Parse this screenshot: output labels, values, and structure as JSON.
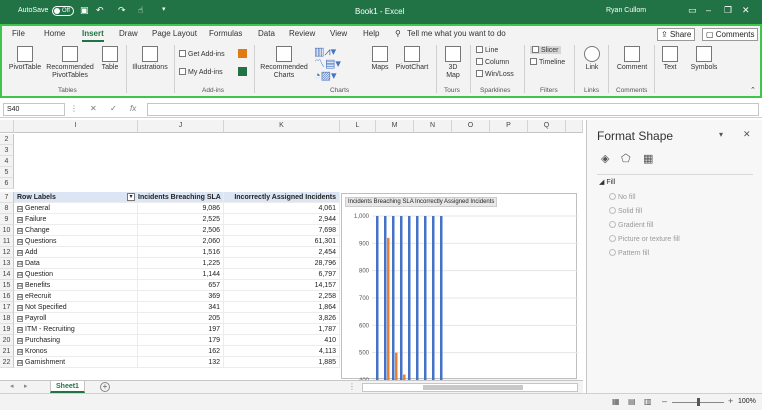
{
  "titlebar": {
    "autosave_label": "AutoSave",
    "autosave_state": "Off",
    "document_title": "Book1 - Excel",
    "user_name": "Ryan Cullom"
  },
  "tabs": [
    "File",
    "Home",
    "Insert",
    "Draw",
    "Page Layout",
    "Formulas",
    "Data",
    "Review",
    "View",
    "Help"
  ],
  "active_tab": "Insert",
  "tell_me_placeholder": "Tell me what you want to do",
  "share_label": "Share",
  "comments_label": "Comments",
  "ribbon": {
    "pivottable": "PivotTable",
    "recommended_pivottables_1": "Recommended",
    "recommended_pivottables_2": "PivotTables",
    "table": "Table",
    "illustrations": "Illustrations",
    "get_addins": "Get Add-ins",
    "my_addins": "My Add-ins",
    "recommended_charts_1": "Recommended",
    "recommended_charts_2": "Charts",
    "maps": "Maps",
    "pivotchart": "PivotChart",
    "map3d_1": "3D",
    "map3d_2": "Map",
    "spark_line": "Line",
    "spark_column": "Column",
    "spark_winloss": "Win/Loss",
    "slicer": "Slicer",
    "timeline": "Timeline",
    "link": "Link",
    "comment": "Comment",
    "text": "Text",
    "symbols": "Symbols",
    "groups": {
      "tables": "Tables",
      "addins": "Add-ins",
      "charts": "Charts",
      "tours": "Tours",
      "sparklines": "Sparklines",
      "filters": "Filters",
      "links": "Links",
      "comments": "Comments"
    }
  },
  "formula_bar": {
    "name_box": "S40",
    "value": ""
  },
  "columns": [
    {
      "label": "I"
    },
    {
      "label": "J"
    },
    {
      "label": "K"
    },
    {
      "label": "L"
    },
    {
      "label": "M"
    },
    {
      "label": "N"
    },
    {
      "label": "O"
    },
    {
      "label": "P"
    },
    {
      "label": "Q"
    }
  ],
  "pivot": {
    "header": {
      "row_labels": "Row Labels",
      "col1": "Incidents Breaching SLA",
      "col2": "Incorrectly Assigned Incidents"
    },
    "rows": [
      {
        "num": "8",
        "label": "General",
        "a": "9,086",
        "b": "4,061"
      },
      {
        "num": "9",
        "label": "Failure",
        "a": "2,525",
        "b": "2,944"
      },
      {
        "num": "10",
        "label": "Change",
        "a": "2,506",
        "b": "7,698"
      },
      {
        "num": "11",
        "label": "Questions",
        "a": "2,060",
        "b": "61,301"
      },
      {
        "num": "12",
        "label": "Add",
        "a": "1,516",
        "b": "2,454"
      },
      {
        "num": "13",
        "label": "Data",
        "a": "1,225",
        "b": "28,796"
      },
      {
        "num": "14",
        "label": "Question",
        "a": "1,144",
        "b": "6,797"
      },
      {
        "num": "15",
        "label": "Benefits",
        "a": "657",
        "b": "14,157"
      },
      {
        "num": "16",
        "label": "eRecruit",
        "a": "369",
        "b": "2,258"
      },
      {
        "num": "17",
        "label": "Not Specified",
        "a": "341",
        "b": "1,864"
      },
      {
        "num": "18",
        "label": "Payroll",
        "a": "205",
        "b": "3,826"
      },
      {
        "num": "19",
        "label": "ITM - Recruiting",
        "a": "197",
        "b": "1,787"
      },
      {
        "num": "20",
        "label": "Purchasing",
        "a": "179",
        "b": "410"
      },
      {
        "num": "21",
        "label": "Kronos",
        "a": "162",
        "b": "4,113"
      },
      {
        "num": "22",
        "label": "Garnishment",
        "a": "132",
        "b": "1,885"
      }
    ]
  },
  "empty_rows": [
    "2",
    "3",
    "4",
    "5",
    "6"
  ],
  "header_row_num": "7",
  "sheet_tab": "Sheet1",
  "chart_data": {
    "type": "bar",
    "title": "Incidents Breaching SLA  Incorrectly Assigned Incidents",
    "ylim": [
      400,
      1000
    ],
    "yticks": [
      "1,000",
      "900",
      "800",
      "700",
      "600",
      "500",
      "400"
    ],
    "series": [
      {
        "name": "Incidents Breaching SLA",
        "color": "#4472c4",
        "values": [
          1000,
          1000,
          1000,
          1000,
          1000,
          1000,
          1000,
          1000,
          1000
        ]
      },
      {
        "name": "Incorrectly Assigned Incidents",
        "color": "#ed7d31",
        "values": [
          400,
          920,
          500,
          420,
          400,
          400,
          400,
          400,
          400
        ]
      }
    ]
  },
  "format_pane": {
    "title": "Format Shape",
    "section": "Fill",
    "options": [
      "No fill",
      "Solid fill",
      "Gradient fill",
      "Picture or texture fill",
      "Pattern fill"
    ]
  },
  "zoom": "100%"
}
